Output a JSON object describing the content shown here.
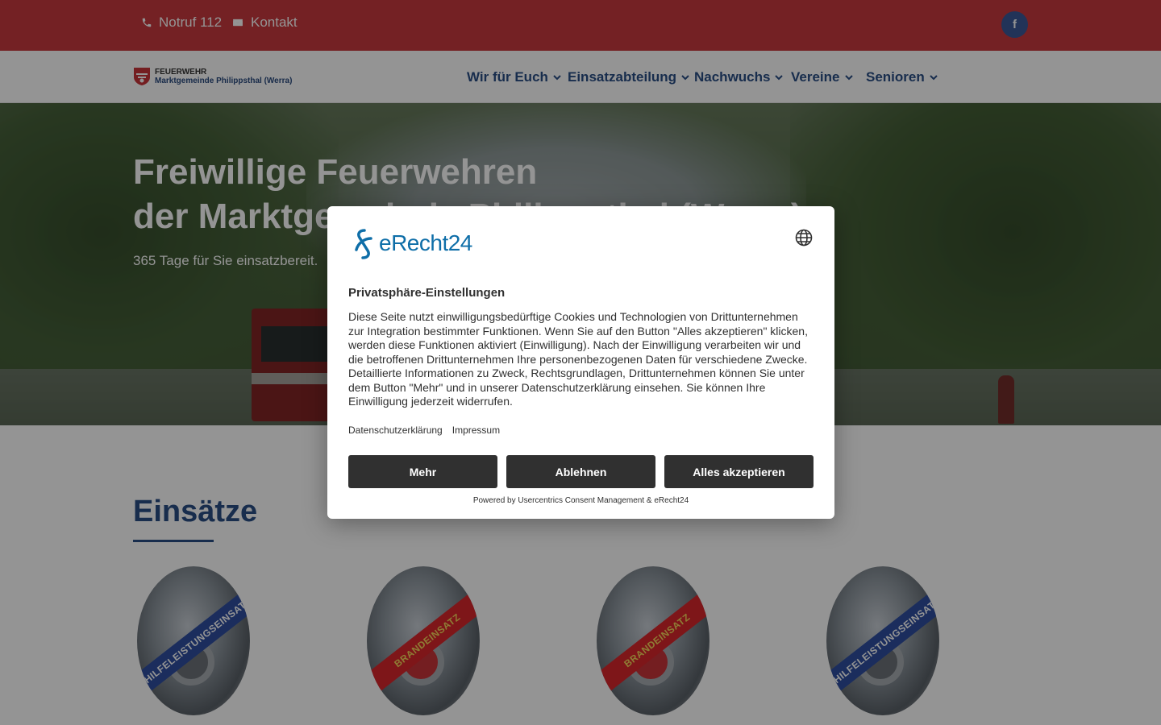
{
  "topbar": {
    "emergency": "Notruf 112",
    "contact": "Kontakt",
    "facebook": "f"
  },
  "logo": {
    "line1": "FEUERWEHR",
    "line2": "Marktgemeinde Philippsthal (Werra)"
  },
  "nav": {
    "items": [
      {
        "label": "Wir für Euch"
      },
      {
        "label": "Einsatzabteilung"
      },
      {
        "label": "Nachwuchs"
      },
      {
        "label": "Vereine"
      },
      {
        "label": "Senioren"
      }
    ]
  },
  "hero": {
    "title_line1": "Freiwillige Feuerwehren",
    "title_line2": "der Marktgemeinde Philippsthal (Werra)",
    "subtitle": "365 Tage für Sie einsatzbereit."
  },
  "section": {
    "title": "Einsätze",
    "cards": [
      {
        "band": "HILFELEISTUNGSEINSATZ",
        "kind": "blue"
      },
      {
        "band": "BRANDEINSATZ",
        "kind": "red"
      },
      {
        "band": "BRANDEINSATZ",
        "kind": "red"
      },
      {
        "band": "HILFELEISTUNGSEINSATZ",
        "kind": "blue"
      }
    ]
  },
  "consent": {
    "brand": "eRecht24",
    "heading": "Privatsphäre-Einstellungen",
    "body": "Diese Seite nutzt einwilligungsbedürftige Cookies und Technologien von Drittunternehmen zur Integration bestimmter Funktionen. Wenn Sie auf den Button \"Alles akzeptieren\" klicken, werden diese Funktionen aktiviert (Einwilligung). Nach der Einwilligung verarbeiten wir und die betroffenen Drittunternehmen Ihre personenbezogenen Daten für verschiedene Zwecke. Detaillierte Informationen zu Zweck, Rechtsgrundlagen, Drittunternehmen können Sie unter dem Button \"Mehr\" und in unserer Datenschutzerklärung einsehen. Sie können Ihre Einwilligung jederzeit widerrufen.",
    "link_privacy": "Datenschutzerklärung",
    "link_imprint": "Impressum",
    "btn_more": "Mehr",
    "btn_decline": "Ablehnen",
    "btn_accept": "Alles akzeptieren",
    "powered": "Powered by Usercentrics Consent Management & eRecht24"
  },
  "colors": {
    "topbar": "#c93a3e",
    "nav_text": "#2a4f86",
    "modal_button": "#303030",
    "brand": "#0e6ea8"
  },
  "icons": [
    "phone-icon",
    "envelope-icon",
    "facebook-icon",
    "chevron-down-icon",
    "globe-icon",
    "erecht24-logo-icon"
  ]
}
